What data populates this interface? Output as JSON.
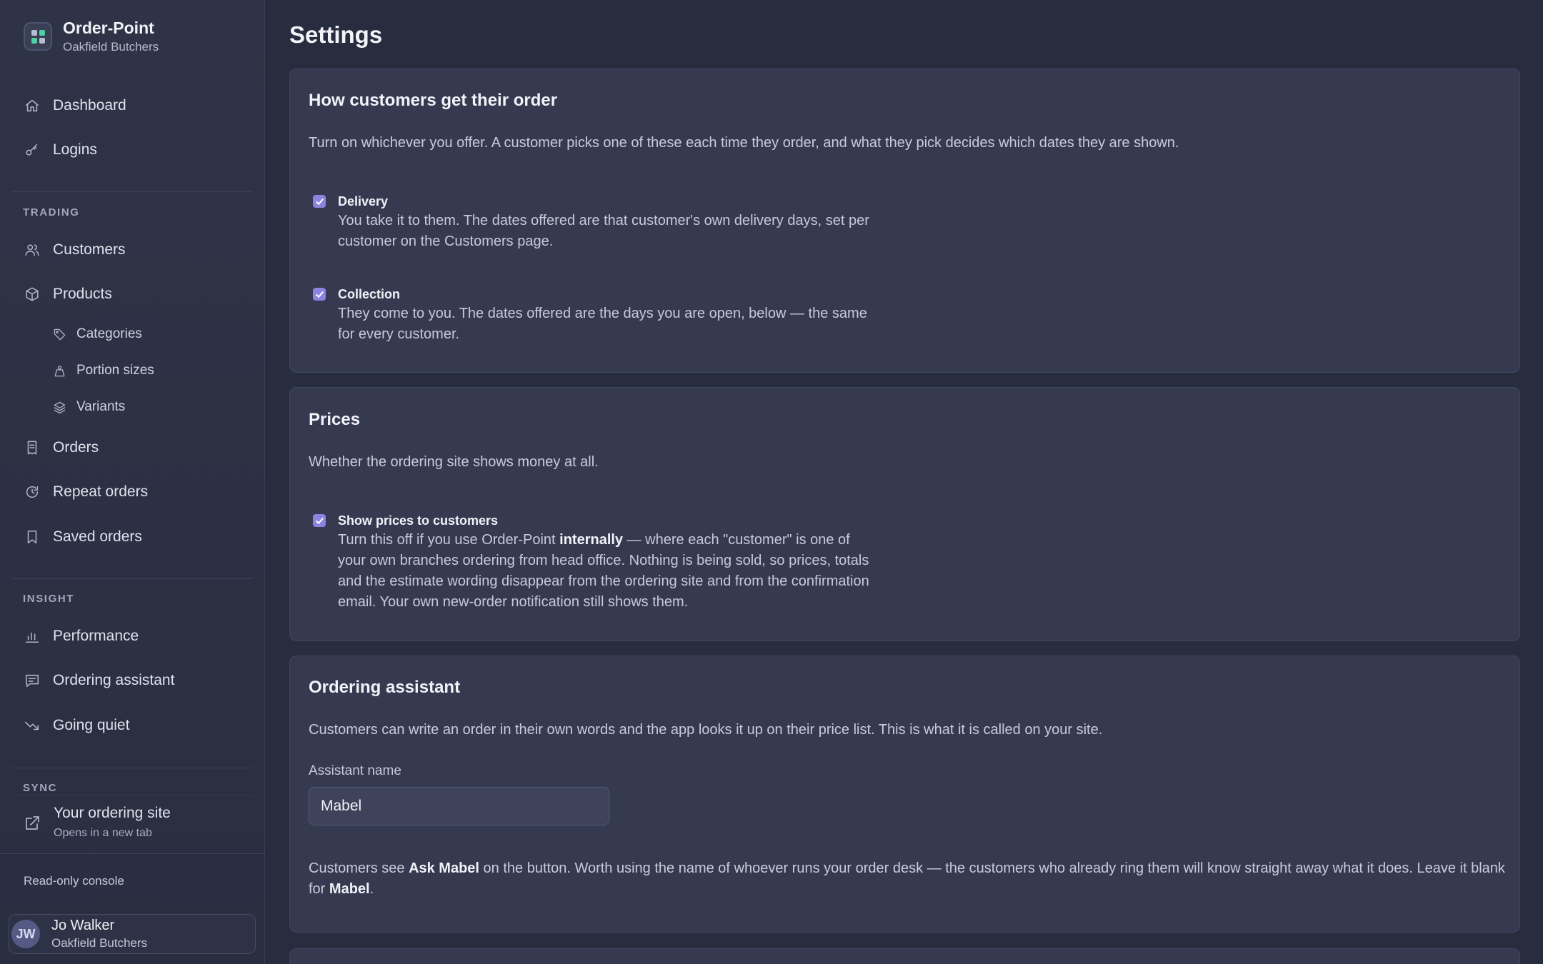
{
  "brand": {
    "name": "Order-Point",
    "business": "Oakfield Butchers"
  },
  "nav": {
    "dashboard": "Dashboard",
    "logins": "Logins",
    "trading_label": "TRADING",
    "customers": "Customers",
    "products": "Products",
    "categories": "Categories",
    "portion_sizes": "Portion sizes",
    "variants": "Variants",
    "orders": "Orders",
    "repeat_orders": "Repeat orders",
    "saved_orders": "Saved orders",
    "insight_label": "INSIGHT",
    "performance": "Performance",
    "ordering_assistant": "Ordering assistant",
    "going_quiet": "Going quiet",
    "sync_label": "SYNC",
    "ordering_site": "Your ordering site",
    "ordering_site_sub": "Opens in a new tab"
  },
  "footer": {
    "readonly": "Read-only console",
    "user": {
      "initials": "JW",
      "name": "Jo Walker",
      "org": "Oakfield Butchers"
    }
  },
  "page": {
    "title": "Settings"
  },
  "fulfilment": {
    "title": "How customers get their order",
    "description": "Turn on whichever you offer. A customer picks one of these each time they order, and what they pick decides which dates they are shown.",
    "delivery": {
      "checked": true,
      "label": "Delivery",
      "description": "You take it to them. The dates offered are that customer's own delivery days, set per customer on the Customers page."
    },
    "collection": {
      "checked": true,
      "label": "Collection",
      "description": "They come to you. The dates offered are the days you are open, below — the same for every customer."
    }
  },
  "prices": {
    "title": "Prices",
    "description": "Whether the ordering site shows money at all.",
    "show_prices": {
      "checked": true,
      "label": "Show prices to customers",
      "desc_part1": "Turn this off if you use Order-Point ",
      "desc_bold": "internally",
      "desc_part2": " — where each \"customer\" is one of your own branches ordering from head office. Nothing is being sold, so prices, totals and the estimate wording disappear from the ordering site and from the confirmation email. Your own new-order notification still shows them."
    }
  },
  "assistant": {
    "title": "Ordering assistant",
    "description": "Customers can write an order in their own words and the app looks it up on their price list. This is what it is called on your site.",
    "name_label": "Assistant name",
    "name_value": "Mabel",
    "foot_part1": "Customers see ",
    "foot_bold1": "Ask Mabel",
    "foot_part2": " on the button. Worth using the name of whoever runs your order desk — the customers who already ring them will know straight away what it does. Leave it blank for ",
    "foot_bold2": "Mabel",
    "foot_part3": "."
  },
  "colors": {
    "accent": "#8b83e0",
    "background": "#282c3f",
    "card": "#363a51",
    "sidebar": "#2f3347"
  }
}
